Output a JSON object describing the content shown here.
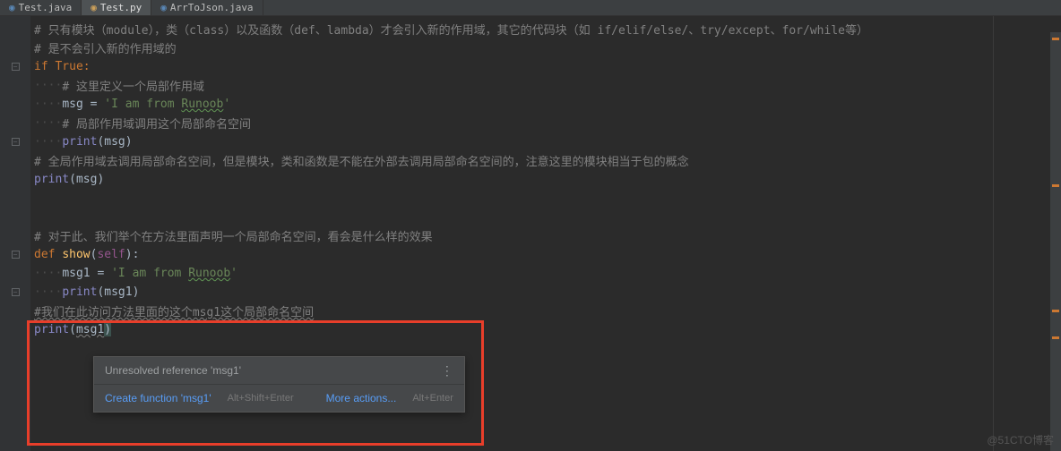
{
  "tabs": [
    {
      "label": "Test.java",
      "active": false
    },
    {
      "label": "Test.py",
      "active": true
    },
    {
      "label": "ArrToJson.java",
      "active": false
    }
  ],
  "code": {
    "l1": "# 只有模块（module），类（class）以及函数（def、lambda）才会引入新的作用域，其它的代码块（如 if/elif/else/、try/except、for/while等）",
    "l2": "# 是不会引入新的作用域的",
    "l3_if": "if",
    "l3_true": " True:",
    "l4": "# 这里定义一个局部作用域",
    "l5_msg": "msg = ",
    "l5_str": "'I am from Runoob'",
    "l6": "# 局部作用域调用这个局部命名空间",
    "l7_print": "print",
    "l7_arg": "(msg)",
    "l8": "# 全局作用域去调用局部命名空间，但是模块，类和函数是不能在外部去调用局部命名空间的，注意这里的模块相当于包的概念",
    "l9_print": "print",
    "l9_arg": "(msg)",
    "l12": "# 对于此、我们举个在方法里面声明一个局部命名空间，看会是什么样的效果",
    "l13_def": "def ",
    "l13_name": "show",
    "l13_self": "self",
    "l14_msg": "msg1 = ",
    "l14_str": "'I am from Runoob'",
    "l15_print": "print",
    "l15_arg": "(msg1)",
    "l16": "#我们在此访问方法里面的这个msg1这个局部命名空间",
    "l17_print": "print",
    "l17_arg1": "msg1"
  },
  "intention": {
    "title": "Unresolved reference 'msg1'",
    "action1": "Create function 'msg1'",
    "hint1": "Alt+Shift+Enter",
    "action2": "More actions...",
    "hint2": "Alt+Enter"
  },
  "watermark": "@51CTO博客"
}
